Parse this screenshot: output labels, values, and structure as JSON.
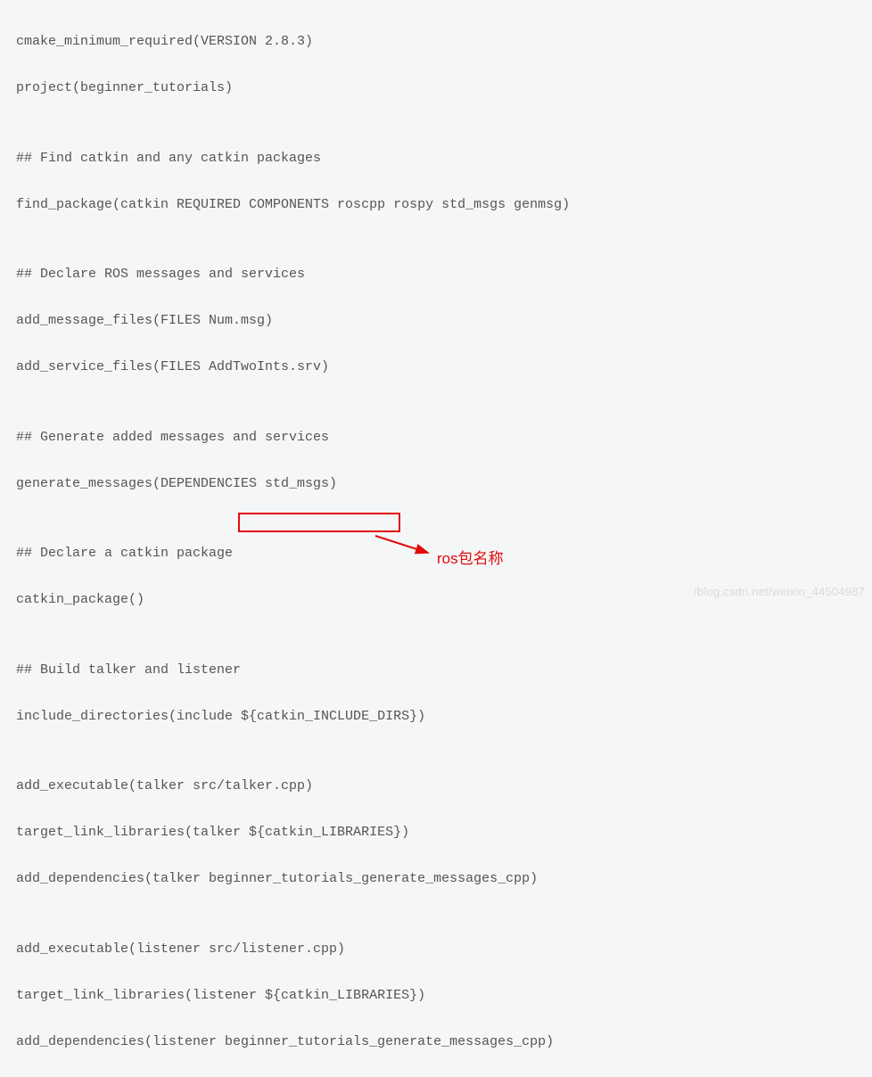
{
  "code": {
    "l1": "cmake_minimum_required(VERSION 2.8.3)",
    "l2": "project(beginner_tutorials)",
    "l3": "",
    "l4": "## Find catkin and any catkin packages",
    "l5": "find_package(catkin REQUIRED COMPONENTS roscpp rospy std_msgs genmsg)",
    "l6": "",
    "l7": "## Declare ROS messages and services",
    "l8": "add_message_files(FILES Num.msg)",
    "l9": "add_service_files(FILES AddTwoInts.srv)",
    "l10": "",
    "l11": "## Generate added messages and services",
    "l12": "generate_messages(DEPENDENCIES std_msgs)",
    "l13": "",
    "l14": "## Declare a catkin package",
    "l15": "catkin_package()",
    "l16": "",
    "l17": "## Build talker and listener",
    "l18": "include_directories(include ${catkin_INCLUDE_DIRS})",
    "l19": "",
    "l20": "add_executable(talker src/talker.cpp)",
    "l21": "target_link_libraries(talker ${catkin_LIBRARIES})",
    "l22_a": "add_dependencies(talker ",
    "l22_b": "beginner_tutorials",
    "l22_c": "_generate_messages_cpp)",
    "l23": "",
    "l24": "add_executable(listener src/listener.cpp)",
    "l25": "target_link_libraries(listener ${catkin_LIBRARIES})",
    "l26": "add_dependencies(listener beginner_tutorials_generate_messages_cpp)"
  },
  "annotation": {
    "label": "ros包名称"
  },
  "watermark": "/blog.csdn.net/weixin_44504987"
}
